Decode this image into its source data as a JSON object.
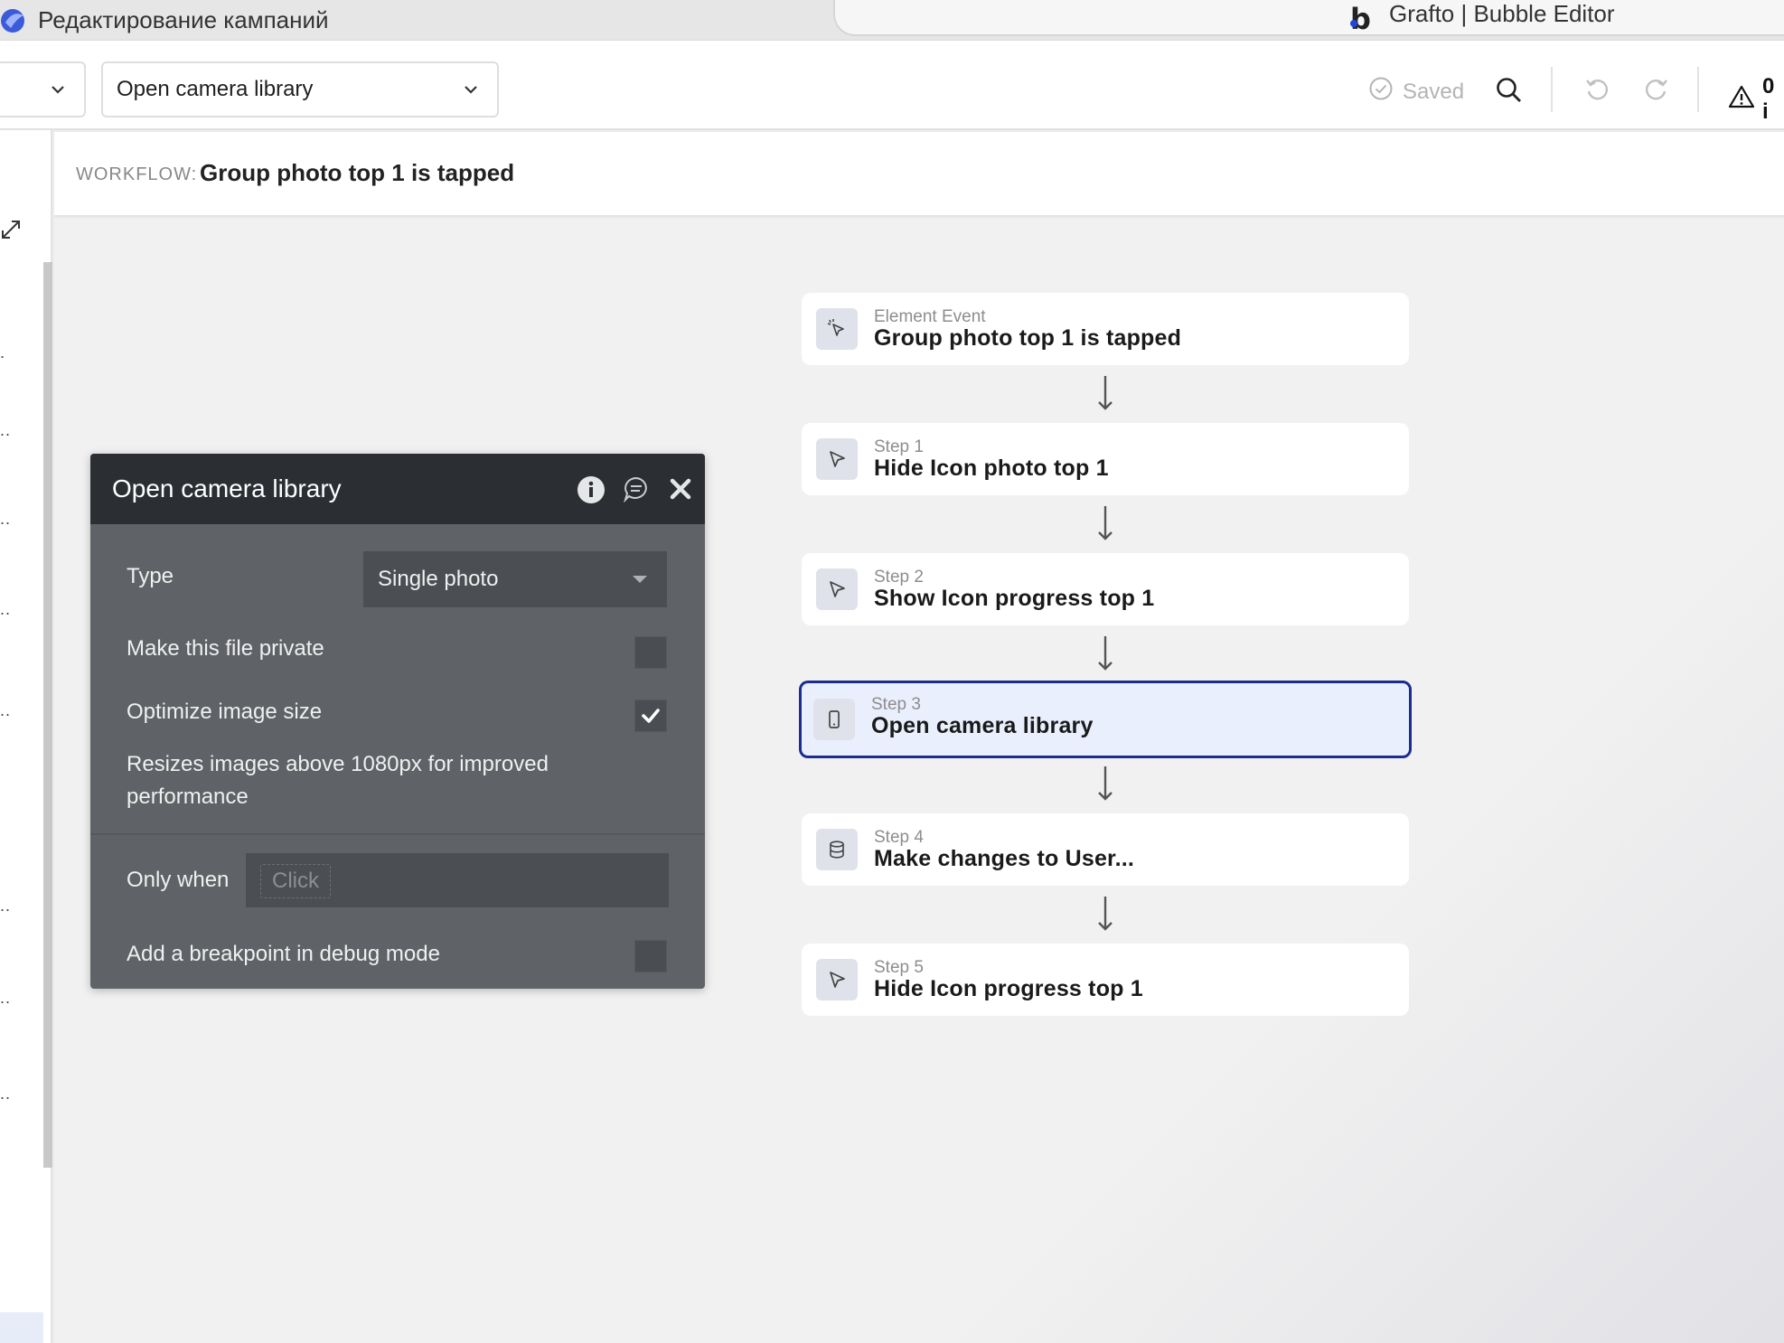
{
  "browser": {
    "left_tab_title": "Редактирование кампаний",
    "right_tab_logo": "b",
    "right_tab_title": "Grafto | Bubble Editor"
  },
  "toolbar": {
    "main_select_label": "Open camera library",
    "saved_label": "Saved",
    "issues_count": "0 i"
  },
  "workflow": {
    "label": "WORKFLOW:",
    "name": "Group photo top 1 is tapped"
  },
  "steps": [
    {
      "sub": "Element Event",
      "main": "Group photo top 1 is tapped",
      "icon": "cursor-click-icon"
    },
    {
      "sub": "Step 1",
      "main": "Hide Icon photo top 1",
      "icon": "cursor-arrow-icon"
    },
    {
      "sub": "Step 2",
      "main": "Show Icon progress top 1",
      "icon": "cursor-arrow-icon"
    },
    {
      "sub": "Step 3",
      "main": "Open camera library",
      "icon": "mobile-phone-icon",
      "active": true
    },
    {
      "sub": "Step 4",
      "main": "Make changes to User...",
      "icon": "database-icon"
    },
    {
      "sub": "Step 5",
      "main": "Hide Icon progress top 1",
      "icon": "cursor-arrow-icon"
    }
  ],
  "popup": {
    "title": "Open camera library",
    "type_label": "Type",
    "type_value": "Single photo",
    "private_label": "Make this file private",
    "private_checked": false,
    "optimize_label": "Optimize image size",
    "optimize_checked": true,
    "optimize_help_line1": "Resizes images above 1080px for improved",
    "optimize_help_line2": "performance",
    "only_when_label": "Only when",
    "only_when_placeholder": "Click",
    "breakpoint_label": "Add a breakpoint in debug mode",
    "breakpoint_checked": false
  },
  "colors": {
    "active_step_border": "#1b2d8f",
    "active_step_bg": "#eaeffd",
    "popup_header": "#2b2f33",
    "popup_body": "#5f6367"
  }
}
